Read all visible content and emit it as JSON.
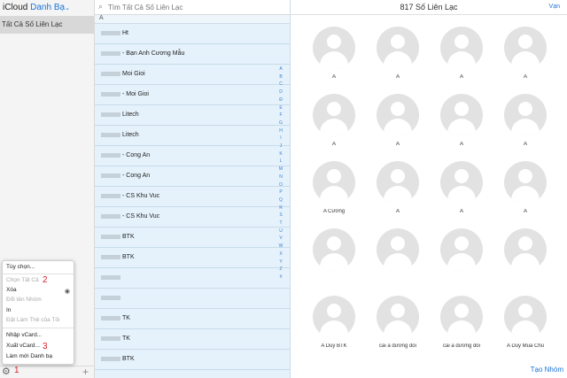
{
  "sidebar": {
    "brand": "iCloud",
    "section": "Danh Bạ",
    "group": "Tất Cả Số Liên Lạc"
  },
  "menu": {
    "items": [
      {
        "label": "Tùy chọn...",
        "disabled": false
      },
      {
        "label": "Chọn Tất Cả",
        "disabled": true
      },
      {
        "label": "Xóa",
        "disabled": false
      },
      {
        "label": "Đổi tên Nhóm",
        "disabled": true
      },
      {
        "label": "In",
        "disabled": false
      },
      {
        "label": "Đặt Làm Thẻ của Tôi",
        "disabled": true
      },
      {
        "label": "Nhập vCard...",
        "disabled": false
      },
      {
        "label": "Xuất vCard...",
        "disabled": false
      },
      {
        "label": "Làm mới Danh bạ",
        "disabled": false
      }
    ]
  },
  "annotations": {
    "a1": "1",
    "a2": "2",
    "a3": "3"
  },
  "list": {
    "search_placeholder": "Tìm Tất Cả Số Liên Lạc",
    "letter": "A",
    "rows": [
      {
        "text": "Ht"
      },
      {
        "text": "- Bạn Anh Cương Mẫu"
      },
      {
        "text": "Moi Gioi"
      },
      {
        "text": "- Moi Gioi"
      },
      {
        "text": "Litech"
      },
      {
        "text": "Litech"
      },
      {
        "text": "- Cong An"
      },
      {
        "text": "- Cong An"
      },
      {
        "text": "- CS Khu Vuc"
      },
      {
        "text": "- CS Khu Vuc"
      },
      {
        "text": "BTK"
      },
      {
        "text": "BTK"
      },
      {
        "text": ""
      },
      {
        "text": ""
      },
      {
        "text": "TK"
      },
      {
        "text": "TK"
      },
      {
        "text": "BTK"
      }
    ],
    "alphabet": [
      "A",
      "B",
      "C",
      "D",
      "Đ",
      "E",
      "F",
      "G",
      "H",
      "I",
      "J",
      "K",
      "L",
      "M",
      "N",
      "O",
      "P",
      "Q",
      "R",
      "S",
      "T",
      "U",
      "V",
      "W",
      "X",
      "Y",
      "Z",
      "#"
    ]
  },
  "main": {
    "title": "817 Số Liên Lạc",
    "view_label": "Vạn",
    "new_group": "Tạo Nhóm",
    "cards": [
      {
        "name": "A"
      },
      {
        "name": "A"
      },
      {
        "name": "A"
      },
      {
        "name": "A"
      },
      {
        "name": "A"
      },
      {
        "name": "A"
      },
      {
        "name": "A"
      },
      {
        "name": "A"
      },
      {
        "name": "A Cương"
      },
      {
        "name": "A"
      },
      {
        "name": "A"
      },
      {
        "name": "A"
      },
      {
        "name": ""
      },
      {
        "name": ""
      },
      {
        "name": ""
      },
      {
        "name": ""
      },
      {
        "name": "A Duy BTK"
      },
      {
        "name": "cai a dương đồi"
      },
      {
        "name": "cai a dương đồi"
      },
      {
        "name": "A Duy Mua Chu"
      }
    ]
  }
}
